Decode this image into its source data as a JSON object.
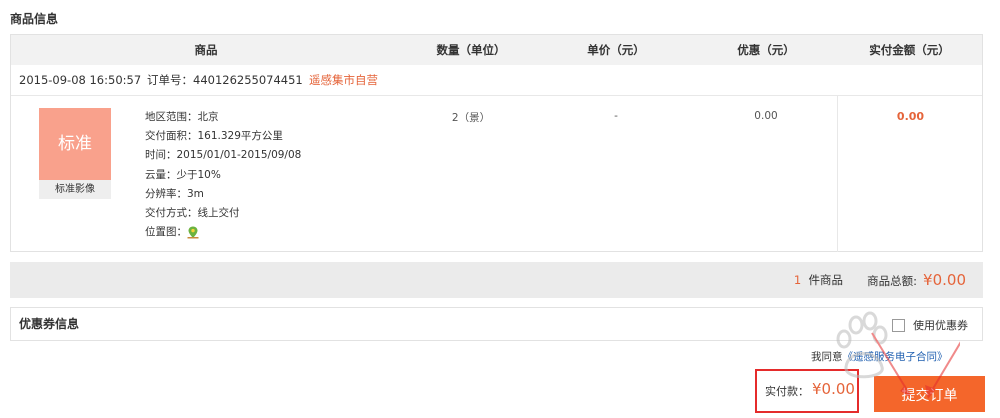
{
  "product_info": {
    "title": "商品信息",
    "headers": [
      "商品",
      "数量（单位）",
      "单价（元）",
      "优惠（元）",
      "实付金额（元）"
    ],
    "order": {
      "date": "2015-09-08 16:50:57",
      "order_no_label": "订单号：",
      "order_no": "440126255074451",
      "shop": "遥感集市自营"
    },
    "item": {
      "thumb_text": "标准",
      "thumb_caption": "标准影像",
      "specs": [
        "地区范围：北京",
        "交付面积：161.329平方公里",
        "时间：2015/01/01-2015/09/08",
        "云量：少于10%",
        "分辨率：3m",
        "交付方式：线上交付",
        "位置图："
      ],
      "quantity": "2（景）",
      "unit_price": "-",
      "discount": "0.00",
      "paid": "0.00"
    }
  },
  "summary": {
    "count": "1",
    "count_unit": "件商品",
    "total_label": "商品总额:",
    "total": "¥0.00"
  },
  "coupon": {
    "title": "优惠券信息",
    "use_label": "使用优惠券"
  },
  "agreement": {
    "prefix": "我同意",
    "link": "《遥感服务电子合同》"
  },
  "payment": {
    "label": "实付款：",
    "amount": "¥0.00",
    "submit_label": "提交订单"
  },
  "colors": {
    "accent": "#e5643a",
    "submit_bg": "#f4662b",
    "highlight_border": "#e52b2b",
    "thumb_bg": "#f9a18c"
  },
  "icons": {
    "map": "map-pin-icon",
    "watermark": "baidu-watermark-icon"
  }
}
